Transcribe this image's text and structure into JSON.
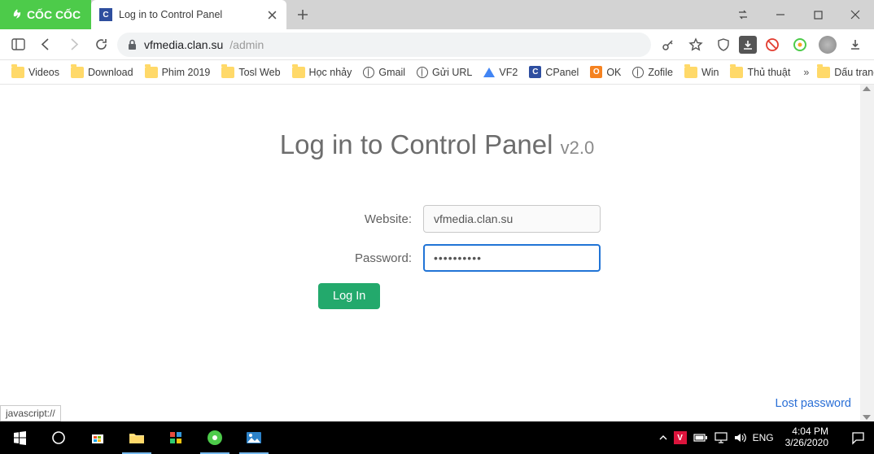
{
  "browser": {
    "logo_text": "CỐC CỐC",
    "tab_title": "Log in to Control Panel",
    "url_host": "vfmedia.clan.su",
    "url_path": "/admin"
  },
  "bookmarks": [
    {
      "label": "Videos",
      "icon": "folder"
    },
    {
      "label": "Download",
      "icon": "folder"
    },
    {
      "label": "Phim 2019",
      "icon": "folder"
    },
    {
      "label": "Tosl Web",
      "icon": "folder"
    },
    {
      "label": "Học nhảy",
      "icon": "folder"
    },
    {
      "label": "Gmail",
      "icon": "globe"
    },
    {
      "label": "Gửi URL",
      "icon": "globe"
    },
    {
      "label": "VF2",
      "icon": "drive"
    },
    {
      "label": "CPanel",
      "icon": "blue-sq",
      "badge": "C"
    },
    {
      "label": "OK",
      "icon": "orange-sq",
      "badge": "O"
    },
    {
      "label": "Zofile",
      "icon": "globe"
    },
    {
      "label": "Win",
      "icon": "folder"
    },
    {
      "label": "Thủ thuật",
      "icon": "folder"
    }
  ],
  "bookmark_overflow_label": "Dấu trang khác",
  "page": {
    "heading_main": "Log in to Control Panel ",
    "heading_version": "v2.0",
    "website_label": "Website:",
    "website_value": "vfmedia.clan.su",
    "password_label": "Password:",
    "password_value": "••••••••••",
    "login_button": "Log In",
    "lost_password": "Lost password"
  },
  "statusbar_text": "javascript://",
  "taskbar": {
    "lang": "ENG",
    "time": "4:04 PM",
    "date": "3/26/2020"
  }
}
